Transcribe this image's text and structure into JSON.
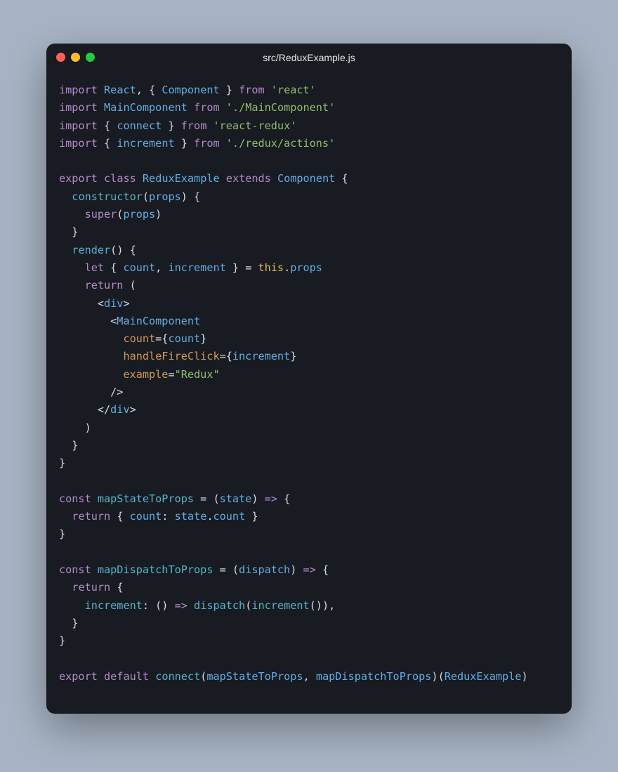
{
  "title": "src/ReduxExample.js",
  "lines": [
    [
      [
        "kw",
        "import"
      ],
      [
        "pun",
        " "
      ],
      [
        "id",
        "React"
      ],
      [
        "pun",
        ", { "
      ],
      [
        "id",
        "Component"
      ],
      [
        "pun",
        " } "
      ],
      [
        "kw",
        "from"
      ],
      [
        "pun",
        " "
      ],
      [
        "str",
        "'react'"
      ]
    ],
    [
      [
        "kw",
        "import"
      ],
      [
        "pun",
        " "
      ],
      [
        "id",
        "MainComponent"
      ],
      [
        "pun",
        " "
      ],
      [
        "kw",
        "from"
      ],
      [
        "pun",
        " "
      ],
      [
        "str",
        "'./MainComponent'"
      ]
    ],
    [
      [
        "kw",
        "import"
      ],
      [
        "pun",
        " { "
      ],
      [
        "id",
        "connect"
      ],
      [
        "pun",
        " } "
      ],
      [
        "kw",
        "from"
      ],
      [
        "pun",
        " "
      ],
      [
        "str",
        "'react-redux'"
      ]
    ],
    [
      [
        "kw",
        "import"
      ],
      [
        "pun",
        " { "
      ],
      [
        "id",
        "increment"
      ],
      [
        "pun",
        " } "
      ],
      [
        "kw",
        "from"
      ],
      [
        "pun",
        " "
      ],
      [
        "str",
        "'./redux/actions'"
      ]
    ],
    [
      [
        "pun",
        ""
      ]
    ],
    [
      [
        "kw",
        "export"
      ],
      [
        "pun",
        " "
      ],
      [
        "kw",
        "class"
      ],
      [
        "pun",
        " "
      ],
      [
        "id",
        "ReduxExample"
      ],
      [
        "pun",
        " "
      ],
      [
        "kw",
        "extends"
      ],
      [
        "pun",
        " "
      ],
      [
        "id",
        "Component"
      ],
      [
        "pun",
        " {"
      ]
    ],
    [
      [
        "pun",
        "  "
      ],
      [
        "fn",
        "constructor"
      ],
      [
        "pun",
        "("
      ],
      [
        "id",
        "props"
      ],
      [
        "pun",
        ") {"
      ]
    ],
    [
      [
        "pun",
        "    "
      ],
      [
        "kw",
        "super"
      ],
      [
        "pun",
        "("
      ],
      [
        "id",
        "props"
      ],
      [
        "pun",
        ")"
      ]
    ],
    [
      [
        "pun",
        "  }"
      ]
    ],
    [
      [
        "pun",
        "  "
      ],
      [
        "fn",
        "render"
      ],
      [
        "pun",
        "() {"
      ]
    ],
    [
      [
        "pun",
        "    "
      ],
      [
        "kw",
        "let"
      ],
      [
        "pun",
        " { "
      ],
      [
        "id",
        "count"
      ],
      [
        "pun",
        ", "
      ],
      [
        "id",
        "increment"
      ],
      [
        "pun",
        " } = "
      ],
      [
        "this",
        "this"
      ],
      [
        "pun",
        "."
      ],
      [
        "id",
        "props"
      ]
    ],
    [
      [
        "pun",
        "    "
      ],
      [
        "kw",
        "return"
      ],
      [
        "pun",
        " ("
      ]
    ],
    [
      [
        "pun",
        "      <"
      ],
      [
        "id",
        "div"
      ],
      [
        "pun",
        ">"
      ]
    ],
    [
      [
        "pun",
        "        <"
      ],
      [
        "id",
        "MainComponent"
      ]
    ],
    [
      [
        "pun",
        "          "
      ],
      [
        "attr",
        "count"
      ],
      [
        "pun",
        "={"
      ],
      [
        "id",
        "count"
      ],
      [
        "pun",
        "}"
      ]
    ],
    [
      [
        "pun",
        "          "
      ],
      [
        "attr",
        "handleFireClick"
      ],
      [
        "pun",
        "={"
      ],
      [
        "id",
        "increment"
      ],
      [
        "pun",
        "}"
      ]
    ],
    [
      [
        "pun",
        "          "
      ],
      [
        "attr",
        "example"
      ],
      [
        "pun",
        "="
      ],
      [
        "str",
        "\"Redux\""
      ]
    ],
    [
      [
        "pun",
        "        />"
      ]
    ],
    [
      [
        "pun",
        "      </"
      ],
      [
        "id",
        "div"
      ],
      [
        "pun",
        ">"
      ]
    ],
    [
      [
        "pun",
        "    )"
      ]
    ],
    [
      [
        "pun",
        "  }"
      ]
    ],
    [
      [
        "pun",
        "}"
      ]
    ],
    [
      [
        "pun",
        ""
      ]
    ],
    [
      [
        "kw",
        "const"
      ],
      [
        "pun",
        " "
      ],
      [
        "fn",
        "mapStateToProps"
      ],
      [
        "pun",
        " = ("
      ],
      [
        "id",
        "state"
      ],
      [
        "pun",
        ") "
      ],
      [
        "kw",
        "=>"
      ],
      [
        "pun",
        " {"
      ]
    ],
    [
      [
        "pun",
        "  "
      ],
      [
        "kw",
        "return"
      ],
      [
        "pun",
        " { "
      ],
      [
        "id",
        "count"
      ],
      [
        "pun",
        ": "
      ],
      [
        "id",
        "state"
      ],
      [
        "pun",
        "."
      ],
      [
        "id",
        "count"
      ],
      [
        "pun",
        " }"
      ]
    ],
    [
      [
        "pun",
        "}"
      ]
    ],
    [
      [
        "pun",
        ""
      ]
    ],
    [
      [
        "kw",
        "const"
      ],
      [
        "pun",
        " "
      ],
      [
        "fn",
        "mapDispatchToProps"
      ],
      [
        "pun",
        " = ("
      ],
      [
        "id",
        "dispatch"
      ],
      [
        "pun",
        ") "
      ],
      [
        "kw",
        "=>"
      ],
      [
        "pun",
        " {"
      ]
    ],
    [
      [
        "pun",
        "  "
      ],
      [
        "kw",
        "return"
      ],
      [
        "pun",
        " {"
      ]
    ],
    [
      [
        "pun",
        "    "
      ],
      [
        "fn",
        "increment"
      ],
      [
        "pun",
        ": () "
      ],
      [
        "kw",
        "=>"
      ],
      [
        "pun",
        " "
      ],
      [
        "fn",
        "dispatch"
      ],
      [
        "pun",
        "("
      ],
      [
        "fn",
        "increment"
      ],
      [
        "pun",
        "()),"
      ]
    ],
    [
      [
        "pun",
        "  }"
      ]
    ],
    [
      [
        "pun",
        "}"
      ]
    ],
    [
      [
        "pun",
        ""
      ]
    ],
    [
      [
        "kw",
        "export"
      ],
      [
        "pun",
        " "
      ],
      [
        "kw",
        "default"
      ],
      [
        "pun",
        " "
      ],
      [
        "fn",
        "connect"
      ],
      [
        "pun",
        "("
      ],
      [
        "id",
        "mapStateToProps"
      ],
      [
        "pun",
        ", "
      ],
      [
        "id",
        "mapDispatchToProps"
      ],
      [
        "pun",
        ")("
      ],
      [
        "id",
        "ReduxExample"
      ],
      [
        "pun",
        ")"
      ]
    ]
  ]
}
